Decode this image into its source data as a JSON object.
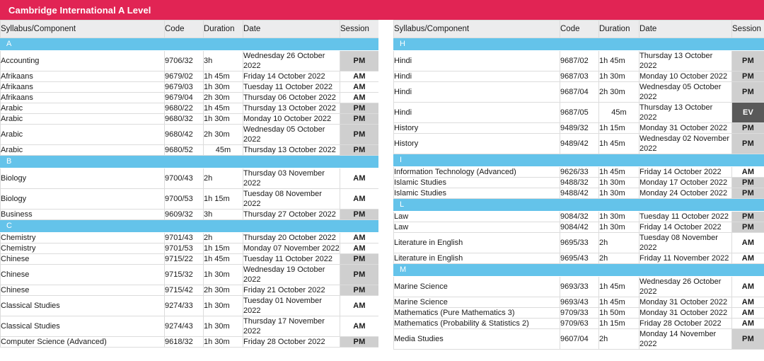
{
  "banner": {
    "title": "Cambridge International A Level",
    "color": "#e12454"
  },
  "colors": {
    "banner": "#e12454",
    "section_bar": "#64c3ea",
    "header_row": "#ececed",
    "session_pm": "#cfcfcf",
    "session_am": "#ffffff",
    "session_ev": "#595959"
  },
  "columns": {
    "syllabus": "Syllabus/Component",
    "code": "Code",
    "duration": "Duration",
    "date": "Date",
    "session": "Session"
  },
  "left_table": {
    "headers": [
      "Syllabus/Component",
      "Code",
      "Duration",
      "Date",
      "Session"
    ],
    "sections": [
      {
        "letter": "A",
        "rows": [
          {
            "name": "Accounting",
            "code": "9706/32",
            "duration": "3h",
            "date": "Wednesday 26 October 2022",
            "session": "PM"
          },
          {
            "name": "Afrikaans",
            "code": "9679/02",
            "duration": "1h 45m",
            "date": "Friday 14 October 2022",
            "session": "AM"
          },
          {
            "name": "Afrikaans",
            "code": "9679/03",
            "duration": "1h 30m",
            "date": "Tuesday 11 October 2022",
            "session": "AM"
          },
          {
            "name": "Afrikaans",
            "code": "9679/04",
            "duration": "2h 30m",
            "date": "Thursday 06 October 2022",
            "session": "AM"
          },
          {
            "name": "Arabic",
            "code": "9680/22",
            "duration": "1h 45m",
            "date": "Thursday 13 October 2022",
            "session": "PM"
          },
          {
            "name": "Arabic",
            "code": "9680/32",
            "duration": "1h 30m",
            "date": "Monday 10 October 2022",
            "session": "PM"
          },
          {
            "name": "Arabic",
            "code": "9680/42",
            "duration": "2h 30m",
            "date": "Wednesday 05 October 2022",
            "session": "PM"
          },
          {
            "name": "Arabic",
            "code": "9680/52",
            "duration": "45m",
            "date": "Thursday 13 October 2022",
            "session": "PM"
          }
        ]
      },
      {
        "letter": "B",
        "rows": [
          {
            "name": "Biology",
            "code": "9700/43",
            "duration": "2h",
            "date": "Thursday 03 November 2022",
            "session": "AM"
          },
          {
            "name": "Biology",
            "code": "9700/53",
            "duration": "1h 15m",
            "date": "Tuesday 08 November 2022",
            "session": "AM"
          },
          {
            "name": "Business",
            "code": "9609/32",
            "duration": "3h",
            "date": "Thursday 27 October 2022",
            "session": "PM"
          }
        ]
      },
      {
        "letter": "C",
        "rows": [
          {
            "name": "Chemistry",
            "code": "9701/43",
            "duration": "2h",
            "date": "Thursday 20 October 2022",
            "session": "AM"
          },
          {
            "name": "Chemistry",
            "code": "9701/53",
            "duration": "1h 15m",
            "date": "Monday 07 November 2022",
            "session": "AM"
          },
          {
            "name": "Chinese",
            "code": "9715/22",
            "duration": "1h 45m",
            "date": "Tuesday 11 October 2022",
            "session": "PM"
          },
          {
            "name": "Chinese",
            "code": "9715/32",
            "duration": "1h 30m",
            "date": "Wednesday 19 October 2022",
            "session": "PM"
          },
          {
            "name": "Chinese",
            "code": "9715/42",
            "duration": "2h 30m",
            "date": "Friday 21 October 2022",
            "session": "PM"
          },
          {
            "name": "Classical Studies",
            "code": "9274/33",
            "duration": "1h 30m",
            "date": "Tuesday 01 November 2022",
            "session": "AM"
          },
          {
            "name": "Classical Studies",
            "code": "9274/43",
            "duration": "1h 30m",
            "date": "Thursday 17 November 2022",
            "session": "AM"
          },
          {
            "name": "Computer Science (Advanced)",
            "code": "9618/32",
            "duration": "1h 30m",
            "date": "Friday 28 October 2022",
            "session": "PM"
          }
        ]
      }
    ]
  },
  "right_table": {
    "headers": [
      "Syllabus/Component",
      "Code",
      "Duration",
      "Date",
      "Session"
    ],
    "sections": [
      {
        "letter": "H",
        "rows": [
          {
            "name": "Hindi",
            "code": "9687/02",
            "duration": "1h 45m",
            "date": "Thursday 13 October 2022",
            "session": "PM"
          },
          {
            "name": "Hindi",
            "code": "9687/03",
            "duration": "1h 30m",
            "date": "Monday 10 October 2022",
            "session": "PM"
          },
          {
            "name": "Hindi",
            "code": "9687/04",
            "duration": "2h 30m",
            "date": "Wednesday 05 October 2022",
            "session": "PM"
          },
          {
            "name": "Hindi",
            "code": "9687/05",
            "duration": "45m",
            "date": "Thursday 13 October 2022",
            "session": "EV"
          },
          {
            "name": "History",
            "code": "9489/32",
            "duration": "1h 15m",
            "date": "Monday 31 October 2022",
            "session": "PM"
          },
          {
            "name": "History",
            "code": "9489/42",
            "duration": "1h 45m",
            "date": "Wednesday 02 November 2022",
            "session": "PM"
          }
        ]
      },
      {
        "letter": "I",
        "rows": [
          {
            "name": "Information Technology (Advanced)",
            "code": "9626/33",
            "duration": "1h 45m",
            "date": "Friday 14 October 2022",
            "session": "AM"
          },
          {
            "name": "Islamic Studies",
            "code": "9488/32",
            "duration": "1h 30m",
            "date": "Monday 17 October 2022",
            "session": "PM"
          },
          {
            "name": "Islamic Studies",
            "code": "9488/42",
            "duration": "1h 30m",
            "date": "Monday 24 October 2022",
            "session": "PM"
          }
        ]
      },
      {
        "letter": "L",
        "rows": [
          {
            "name": "Law",
            "code": "9084/32",
            "duration": "1h 30m",
            "date": "Tuesday 11 October 2022",
            "session": "PM"
          },
          {
            "name": "Law",
            "code": "9084/42",
            "duration": "1h 30m",
            "date": "Friday 14 October 2022",
            "session": "PM"
          },
          {
            "name": "Literature in English",
            "code": "9695/33",
            "duration": "2h",
            "date": "Tuesday 08 November 2022",
            "session": "AM"
          },
          {
            "name": "Literature in English",
            "code": "9695/43",
            "duration": "2h",
            "date": "Friday 11 November 2022",
            "session": "AM"
          }
        ]
      },
      {
        "letter": "M",
        "rows": [
          {
            "name": "Marine Science",
            "code": "9693/33",
            "duration": "1h 45m",
            "date": "Wednesday 26 October 2022",
            "session": "AM"
          },
          {
            "name": "Marine Science",
            "code": "9693/43",
            "duration": "1h 45m",
            "date": "Monday 31 October 2022",
            "session": "AM"
          },
          {
            "name": "Mathematics (Pure Mathematics 3)",
            "code": "9709/33",
            "duration": "1h 50m",
            "date": "Monday 31 October 2022",
            "session": "AM"
          },
          {
            "name": "Mathematics (Probability & Statistics 2)",
            "code": "9709/63",
            "duration": "1h 15m",
            "date": "Friday 28 October 2022",
            "session": "AM"
          },
          {
            "name": "Media Studies",
            "code": "9607/04",
            "duration": "2h",
            "date": "Monday 14 November 2022",
            "session": "PM"
          }
        ]
      }
    ]
  }
}
